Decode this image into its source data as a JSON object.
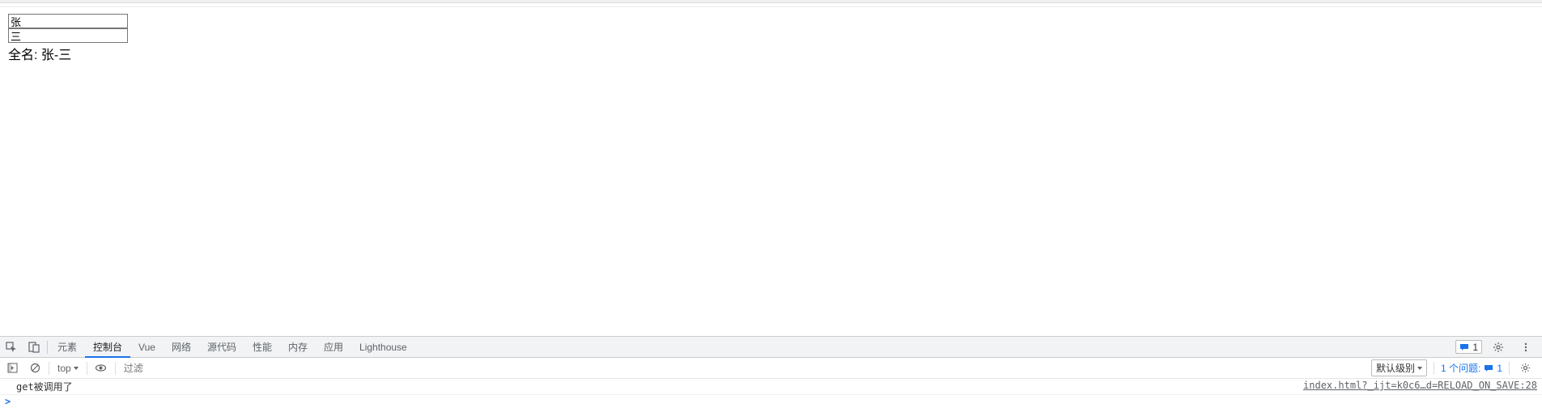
{
  "page": {
    "input1_value": "张",
    "input2_value": "三",
    "fullname_label": "全名:",
    "fullname_value": "张-三"
  },
  "devtools": {
    "tabs": [
      "元素",
      "控制台",
      "Vue",
      "网络",
      "源代码",
      "性能",
      "内存",
      "应用",
      "Lighthouse"
    ],
    "active_tab": "控制台",
    "badge_count": "1",
    "console_toolbar": {
      "context": "top",
      "filter_placeholder": "过滤",
      "levels_label": "默认级别",
      "issues_label": "1 个问题:",
      "issues_count": "1"
    },
    "console": {
      "log_message": "get被调用了",
      "source_link": "index.html?_ijt=k0c6…d=RELOAD_ON_SAVE:28"
    }
  }
}
